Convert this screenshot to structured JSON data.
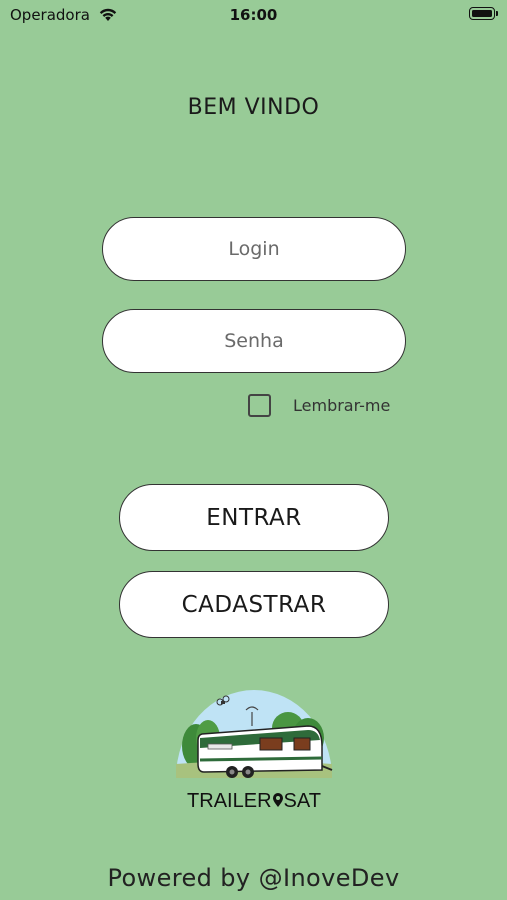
{
  "status_bar": {
    "carrier": "Operadora",
    "time": "16:00"
  },
  "welcome_title": "BEM VINDO",
  "login_field": {
    "placeholder": "Login",
    "value": ""
  },
  "password_field": {
    "placeholder": "Senha",
    "value": ""
  },
  "remember_me": {
    "label": "Lembrar-me",
    "checked": false
  },
  "buttons": {
    "enter": "ENTRAR",
    "register": "CADASTRAR"
  },
  "logo": {
    "text_left": "TRAILER",
    "text_right": "SAT"
  },
  "footer": "Powered by @InoveDev",
  "colors": {
    "background": "#98cb97",
    "trailer_green": "#2e6b3a",
    "sky": "#bfe3f5"
  }
}
